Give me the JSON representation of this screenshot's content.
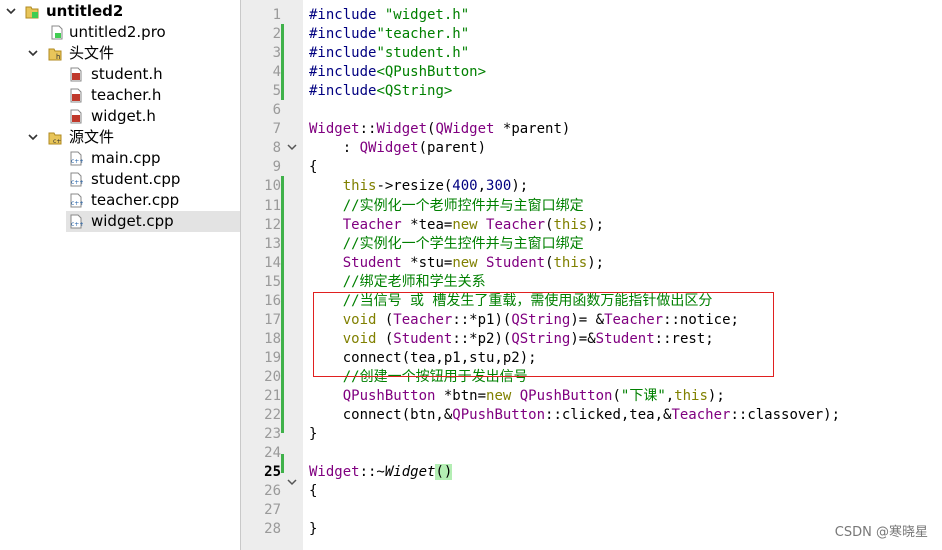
{
  "project_tree": {
    "project_name": "untitled2",
    "pro_file": "untitled2.pro",
    "headers_folder": "头文件",
    "headers": [
      "student.h",
      "teacher.h",
      "widget.h"
    ],
    "sources_folder": "源文件",
    "sources": [
      "main.cpp",
      "student.cpp",
      "teacher.cpp",
      "widget.cpp"
    ],
    "selected": "widget.cpp"
  },
  "editor": {
    "line_numbers": [
      "1",
      "2",
      "3",
      "4",
      "5",
      "6",
      "7",
      "8",
      "9",
      "10",
      "11",
      "12",
      "13",
      "14",
      "15",
      "16",
      "17",
      "18",
      "19",
      "20",
      "21",
      "22",
      "23",
      "24",
      "25",
      "26",
      "27",
      "28"
    ],
    "current_line": "25",
    "lines": [
      [
        "#include \"widget.h\""
      ],
      [
        "#include\"teacher.h\""
      ],
      [
        "#include\"student.h\""
      ],
      [
        "#include<QPushButton>"
      ],
      [
        "#include<QString>"
      ],
      [
        ""
      ],
      [
        "Widget::Widget(QWidget *parent)"
      ],
      [
        "    : QWidget(parent)"
      ],
      [
        "{"
      ],
      [
        "    this->resize(400,300);"
      ],
      [
        "    //实例化一个老师控件并与主窗口绑定"
      ],
      [
        "    Teacher *tea=new Teacher(this);"
      ],
      [
        "    //实例化一个学生控件并与主窗口绑定"
      ],
      [
        "    Student *stu=new Student(this);"
      ],
      [
        "    //绑定老师和学生关系"
      ],
      [
        "    //当信号 或 槽发生了重载，需使用函数万能指针做出区分"
      ],
      [
        "    void (Teacher::*p1)(QString)= &Teacher::notice;"
      ],
      [
        "    void (Student::*p2)(QString)=&Student::rest;"
      ],
      [
        "    connect(tea,p1,stu,p2);"
      ],
      [
        "    //创建一个按钮用于发出信号"
      ],
      [
        "    QPushButton *btn=new QPushButton(\"下课\",this);"
      ],
      [
        "    connect(btn,&QPushButton::clicked,tea,&Teacher::classover);"
      ],
      [
        "}"
      ],
      [
        ""
      ],
      [
        "Widget::~Widget()"
      ],
      [
        "{"
      ],
      [
        ""
      ],
      [
        "}"
      ]
    ]
  },
  "colors": {
    "keyword": "#808000",
    "type": "#800080",
    "string": "#008000",
    "comment": "#008000",
    "number": "#000080",
    "highlight_box": "#e02020"
  },
  "watermark": "CSDN @寒晓星"
}
